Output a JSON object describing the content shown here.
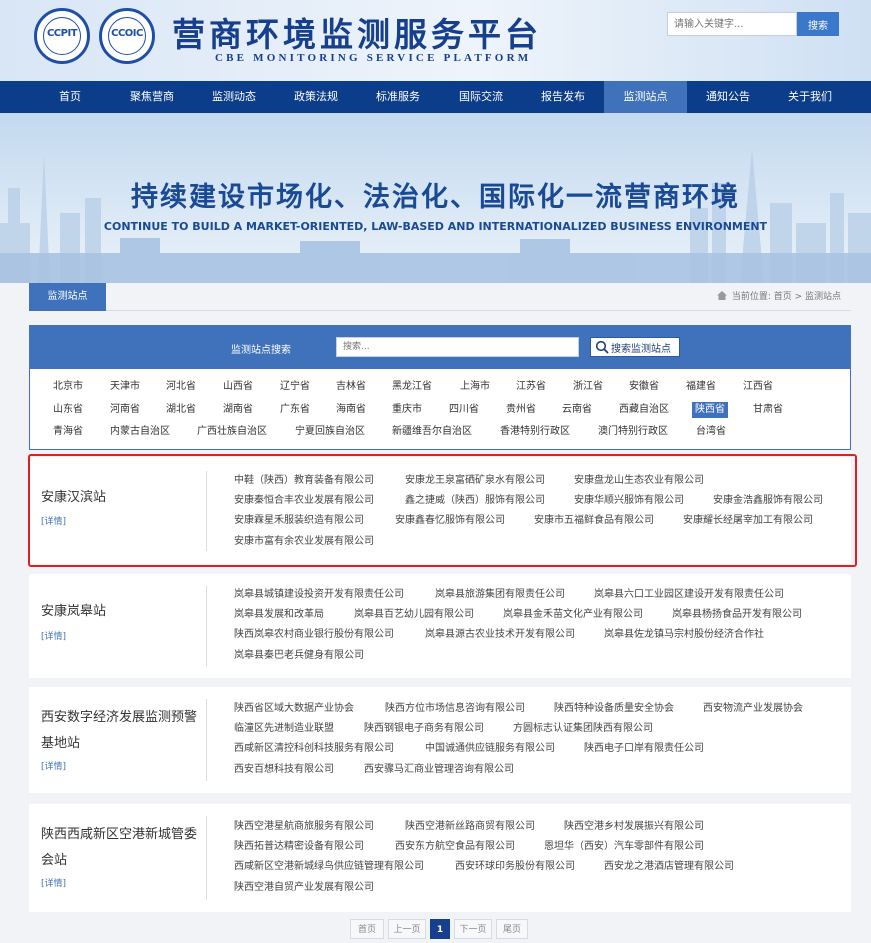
{
  "header": {
    "logo1_text": "CCPIT",
    "logo2_text": "CCOIC",
    "title": "营商环境监测服务平台",
    "subtitle": "CBE MONITORING SERVICE PLATFORM",
    "search_placeholder": "请输入关键字...",
    "search_button": "搜索"
  },
  "nav": {
    "items": [
      "首页",
      "聚焦营商",
      "监测动态",
      "政策法规",
      "标准服务",
      "国际交流",
      "报告发布",
      "监测站点",
      "通知公告",
      "关于我们"
    ],
    "active": "监测站点"
  },
  "banner": {
    "title_cn": "持续建设市场化、法治化、国际化一流营商环境",
    "title_en": "CONTINUE TO BUILD A MARKET-ORIENTED, LAW-BASED AND INTERNATIONALIZED BUSINESS ENVIRONMENT"
  },
  "section": {
    "tab": "监测站点",
    "breadcrumb": "当前位置: 首页 > 监测站点"
  },
  "station_search": {
    "label": "监测站点搜索",
    "placeholder": "搜索...",
    "button": "搜索监测站点"
  },
  "provinces": {
    "rows": [
      [
        "北京市",
        "天津市",
        "河北省",
        "山西省",
        "辽宁省",
        "吉林省",
        "黑龙江省",
        "上海市",
        "江苏省",
        "浙江省",
        "安徽省",
        "福建省",
        "江西省"
      ],
      [
        "山东省",
        "河南省",
        "湖北省",
        "湖南省",
        "广东省",
        "海南省",
        "重庆市",
        "四川省",
        "贵州省",
        "云南省",
        "西藏自治区",
        "陕西省",
        "甘肃省"
      ],
      [
        "青海省",
        "内蒙古自治区",
        "广西壮族自治区",
        "宁夏回族自治区",
        "新疆维吾尔自治区",
        "香港特别行政区",
        "澳门特别行政区",
        "台湾省"
      ]
    ],
    "active": "陕西省"
  },
  "stations": [
    {
      "name": "安康汉滨站",
      "detail": "[详情]",
      "companies": [
        [
          "中鞋（陕西）教育装备有限公司",
          "安康龙王泉富硒矿泉水有限公司",
          "安康盘龙山生态农业有限公司"
        ],
        [
          "安康秦恒合丰农业发展有限公司",
          "鑫之捷威（陕西）服饰有限公司",
          "安康华顺兴服饰有限公司",
          "安康金浩鑫服饰有限公司"
        ],
        [
          "安康霖星禾服装织造有限公司",
          "安康鑫春忆服饰有限公司",
          "安康市五福鲜食品有限公司",
          "安康耀长经屠宰加工有限公司"
        ],
        [
          "安康市富有余农业发展有限公司"
        ]
      ]
    },
    {
      "name": "安康岚皋站",
      "detail": "[详情]",
      "companies": [
        [
          "岚皋县城镇建设投资开发有限责任公司",
          "岚皋县旅游集团有限责任公司",
          "岚皋县六口工业园区建设开发有限责任公司"
        ],
        [
          "岚皋县发展和改革局",
          "岚皋县百艺幼儿园有限公司",
          "岚皋县金禾苗文化产业有限公司",
          "岚皋县杨扬食品开发有限公司"
        ],
        [
          "陕西岚皋农村商业银行股份有限公司",
          "岚皋县源古农业技术开发有限公司",
          "岚皋县佐龙镇马宗村股份经济合作社"
        ],
        [
          "岚皋县秦巴老兵健身有限公司"
        ]
      ]
    },
    {
      "name": "西安数字经济发展监测预警基地站",
      "detail": "[详情]",
      "companies": [
        [
          "陕西省区域大数据产业协会",
          "陕西方位市场信息咨询有限公司",
          "陕西特种设备质量安全协会",
          "西安物流产业发展协会"
        ],
        [
          "临潼区先进制造业联盟",
          "陕西钢银电子商务有限公司",
          "方圆标志认证集团陕西有限公司"
        ],
        [
          "西咸新区清控科创科技服务有限公司",
          "中国诚通供应链服务有限公司",
          "陕西电子口岸有限责任公司"
        ],
        [
          "西安百想科技有限公司",
          "西安骤马汇商业管理咨询有限公司"
        ]
      ]
    },
    {
      "name": "陕西西咸新区空港新城管委会站",
      "detail": "[详情]",
      "companies": [
        [
          "陕西空港星航商旅服务有限公司",
          "陕西空港新丝路商贸有限公司",
          "陕西空港乡村发展振兴有限公司"
        ],
        [
          "陕西拓普达精密设备有限公司",
          "西安东方航空食品有限公司",
          "恩坦华（西安）汽车零部件有限公司"
        ],
        [
          "西咸新区空港新城绿鸟供应链管理有限公司",
          "西安环球印务股份有限公司",
          "西安龙之港酒店管理有限公司"
        ],
        [
          "陕西空港自贸产业发展有限公司"
        ]
      ]
    }
  ],
  "pagination": {
    "first": "首页",
    "prev": "上一页",
    "current": "1",
    "next": "下一页",
    "last": "尾页"
  },
  "colors": {
    "brand": "#163f8e",
    "nav_bg": "#0c3d8a",
    "accent": "#3f72ba",
    "highlight": "#e02020"
  }
}
